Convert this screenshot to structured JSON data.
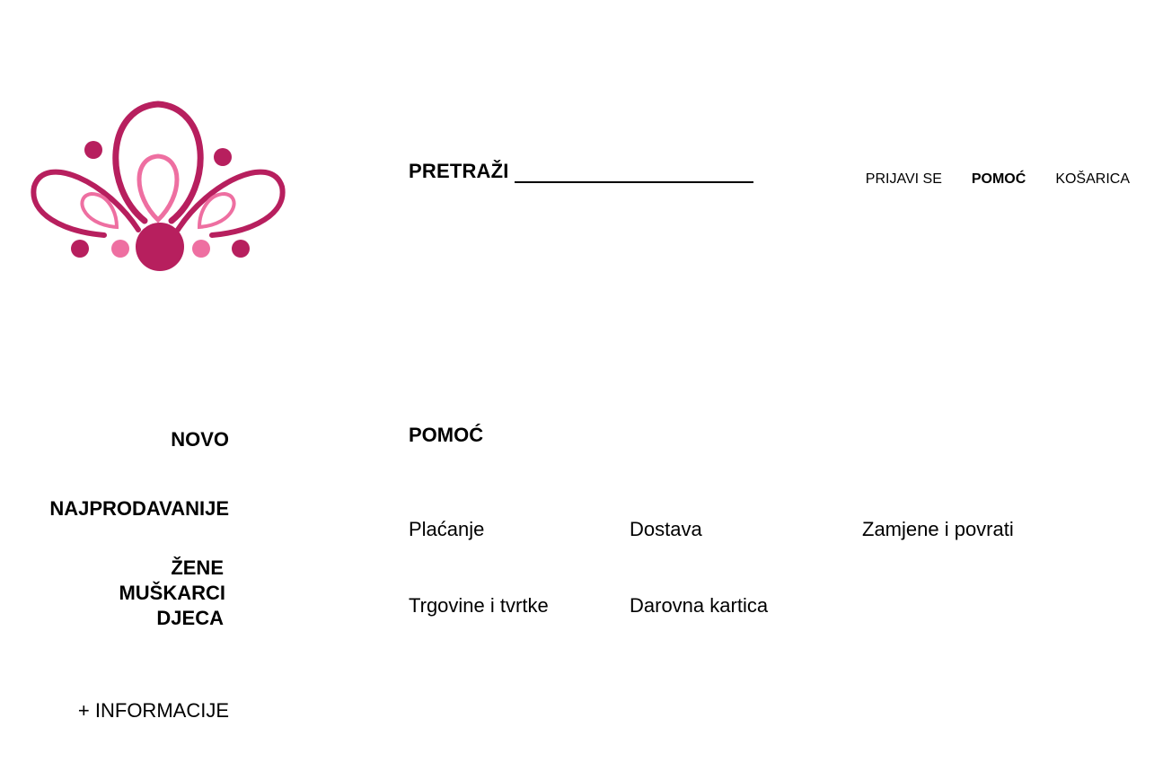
{
  "colors": {
    "logo_dark": "#B71F5E",
    "logo_light": "#EE6FA1",
    "text": "#000000",
    "background": "#FFFFFF"
  },
  "header": {
    "search_label": "PRETRAŽI",
    "search_value": "",
    "nav": {
      "login": "PRIJAVI SE",
      "help": "POMOĆ",
      "cart": "KOŠARICA"
    }
  },
  "sidebar": {
    "new": "NOVO",
    "bestsellers": "NAJPRODAVANIJE",
    "categories": [
      "ŽENE",
      "MUŠKARCI",
      "DJECA"
    ],
    "info": "+ INFORMACIJE"
  },
  "main": {
    "title": "POMOĆ",
    "links": [
      "Plaćanje",
      "Dostava",
      "Zamjene i povrati",
      "Trgovine i tvrtke",
      "Darovna kartica"
    ]
  }
}
